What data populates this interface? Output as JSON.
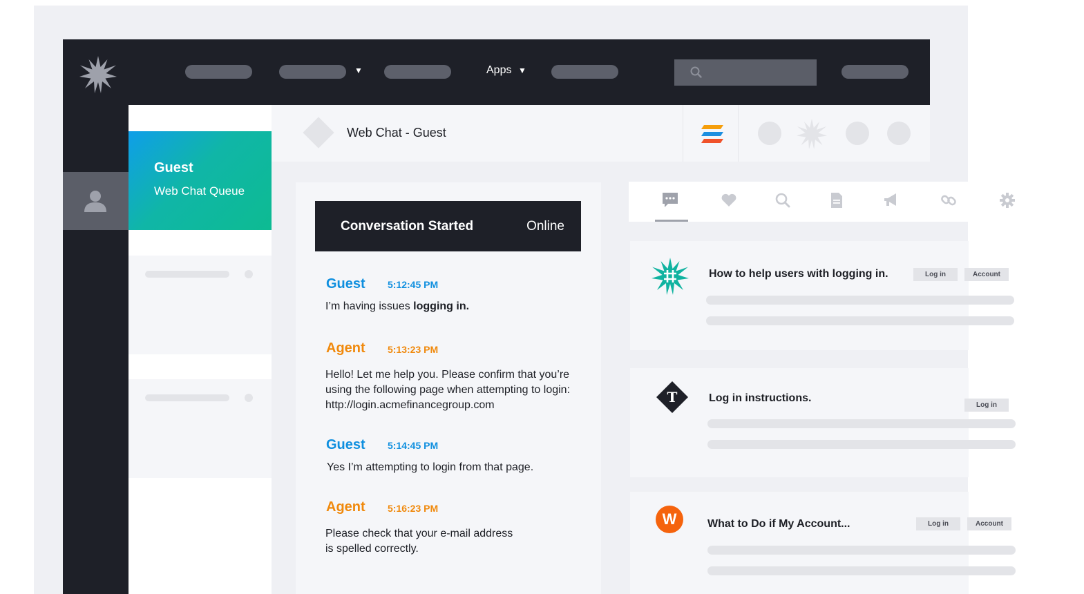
{
  "nav": {
    "apps_label": "Apps",
    "apps_caret": "▼",
    "menu_caret": "▼"
  },
  "queue": {
    "active_name": "Guest",
    "active_queue": "Web Chat Queue"
  },
  "header": {
    "title": "Web Chat - Guest"
  },
  "chat": {
    "banner_title": "Conversation Started",
    "banner_status": "Online",
    "messages": [
      {
        "sender": "Guest",
        "time": "5:12:45 PM",
        "text_plain": "I’m having issues ",
        "text_bold": "logging in."
      },
      {
        "sender": "Agent",
        "time": "5:13:23 PM",
        "line1": "Hello! Let me help you. Please confirm that you’re",
        "line2": "using the following page when attempting to login:",
        "line3": "http://login.acmefinancegroup.com"
      },
      {
        "sender": "Guest",
        "time": "5:14:45 PM",
        "text": "Yes I’m attempting to login from that page."
      },
      {
        "sender": "Agent",
        "time": "5:16:23 PM",
        "line1": "Please check that your e-mail address",
        "line2": "is spelled correctly."
      }
    ]
  },
  "tabs": [
    {
      "name": "chat-tab",
      "icon": "chat-bubble-icon",
      "active": true
    },
    {
      "name": "favorites-tab",
      "icon": "heart-icon"
    },
    {
      "name": "search-tab",
      "icon": "search-icon"
    },
    {
      "name": "documents-tab",
      "icon": "document-icon"
    },
    {
      "name": "announcements-tab",
      "icon": "megaphone-icon"
    },
    {
      "name": "links-tab",
      "icon": "link-icon"
    },
    {
      "name": "settings-tab",
      "icon": "gear-icon"
    }
  ],
  "articles": [
    {
      "title": "How to help users with logging in.",
      "tags": [
        "Log in",
        "Account"
      ],
      "icon": "starburst-hash-icon"
    },
    {
      "title": "Log in instructions.",
      "tags": [
        "Log in"
      ],
      "icon": "t-diamond-icon"
    },
    {
      "title": "What to Do if My Account...",
      "tags": [
        "Log in",
        "Account"
      ],
      "icon": "w-circle-icon",
      "badge_letter": "W"
    }
  ],
  "colors": {
    "nav_bg": "#1e2028",
    "guest": "#0f8fdf",
    "agent": "#f0890c",
    "queue_gradient_start": "#0f9ee9",
    "queue_gradient_end": "#0dbb92",
    "teal_icon": "#10b3a0",
    "orange_badge": "#f5630d"
  }
}
